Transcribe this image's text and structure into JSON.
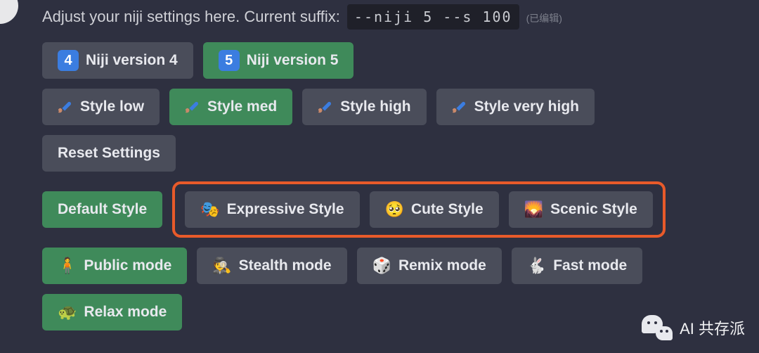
{
  "header": {
    "prompt": "Adjust your niji settings here. Current suffix:",
    "suffix_code": "--niji 5 --s 100",
    "edited_label": "(已编辑)"
  },
  "rows": {
    "versions": [
      {
        "num": "4",
        "label": "Niji version 4",
        "active": false
      },
      {
        "num": "5",
        "label": "Niji version 5",
        "active": true
      }
    ],
    "style_levels": [
      {
        "icon": "paintbrush-icon",
        "label": "Style low",
        "active": false
      },
      {
        "icon": "paintbrush-icon",
        "label": "Style med",
        "active": true
      },
      {
        "icon": "paintbrush-icon",
        "label": "Style high",
        "active": false
      },
      {
        "icon": "paintbrush-icon",
        "label": "Style very high",
        "active": false
      }
    ],
    "reset": {
      "label": "Reset Settings"
    },
    "styles": {
      "default": {
        "label": "Default Style",
        "active": true
      },
      "highlighted": [
        {
          "emoji": "🎭",
          "label": "Expressive Style"
        },
        {
          "emoji": "🥺",
          "label": "Cute Style"
        },
        {
          "emoji": "🌄",
          "label": "Scenic Style"
        }
      ]
    },
    "modes_row1": [
      {
        "emoji": "🧍",
        "label": "Public mode",
        "active": true
      },
      {
        "emoji": "🕵️",
        "label": "Stealth mode",
        "active": false
      },
      {
        "emoji": "🎲",
        "label": "Remix mode",
        "active": false
      },
      {
        "emoji": "🐇",
        "label": "Fast mode",
        "active": false
      }
    ],
    "modes_row2": [
      {
        "emoji": "🐢",
        "label": "Relax mode",
        "active": true
      }
    ]
  },
  "watermark": {
    "label": "AI 共存派"
  }
}
